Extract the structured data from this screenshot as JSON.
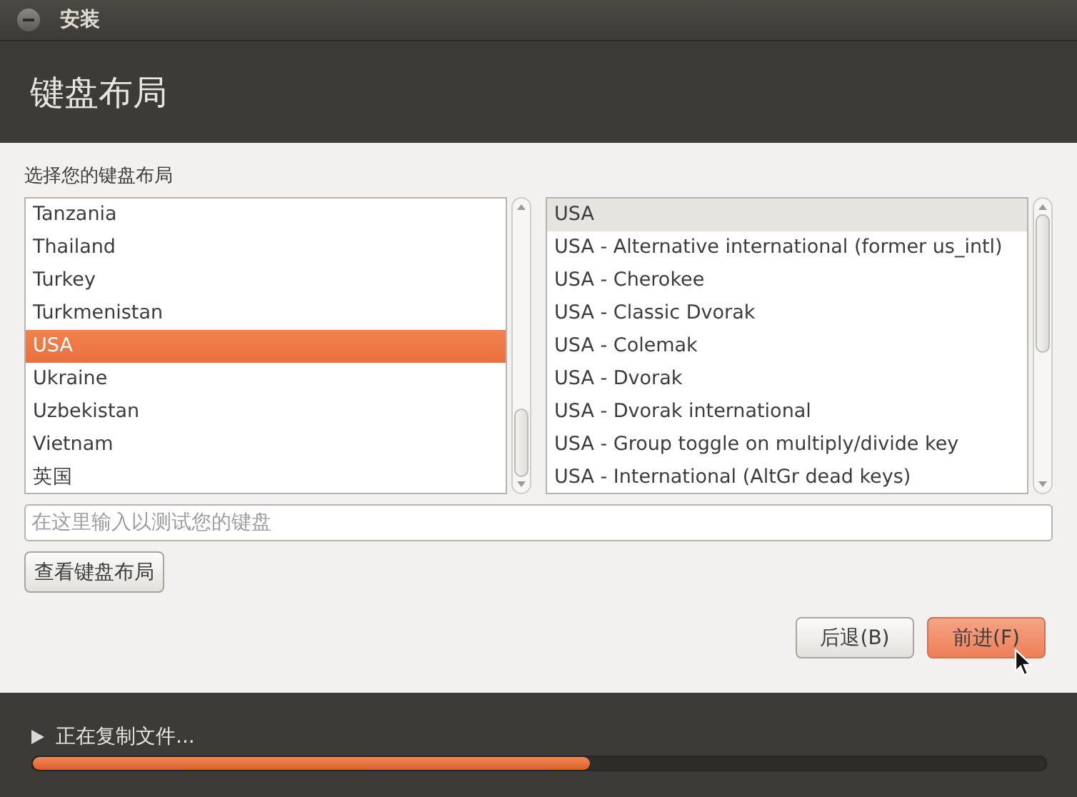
{
  "window": {
    "title": "安装"
  },
  "header": {
    "title": "键盘布局"
  },
  "layout_label": "选择您的键盘布局",
  "layouts": [
    {
      "label": "Tanzania",
      "selected": false
    },
    {
      "label": "Thailand",
      "selected": false
    },
    {
      "label": "Turkey",
      "selected": false
    },
    {
      "label": "Turkmenistan",
      "selected": false
    },
    {
      "label": "USA",
      "selected": true
    },
    {
      "label": "Ukraine",
      "selected": false
    },
    {
      "label": "Uzbekistan",
      "selected": false
    },
    {
      "label": "Vietnam",
      "selected": false
    },
    {
      "label": "英国",
      "selected": false
    }
  ],
  "variants": [
    {
      "label": "USA",
      "selected": true
    },
    {
      "label": "USA - Alternative international (former us_intl)",
      "selected": false
    },
    {
      "label": "USA - Cherokee",
      "selected": false
    },
    {
      "label": "USA - Classic Dvorak",
      "selected": false
    },
    {
      "label": "USA - Colemak",
      "selected": false
    },
    {
      "label": "USA - Dvorak",
      "selected": false
    },
    {
      "label": "USA - Dvorak international",
      "selected": false
    },
    {
      "label": "USA - Group toggle on multiply/divide key",
      "selected": false
    },
    {
      "label": "USA - International (AltGr dead keys)",
      "selected": false
    }
  ],
  "test_field": {
    "placeholder": "在这里输入以测试您的键盘"
  },
  "show_layout_button": "查看键盘布局",
  "buttons": [
    {
      "label": "后退(B)",
      "kind": "normal"
    },
    {
      "label": "前进(F)",
      "kind": "primary"
    }
  ],
  "progress": {
    "label": "正在复制文件...",
    "level": 0.55
  }
}
